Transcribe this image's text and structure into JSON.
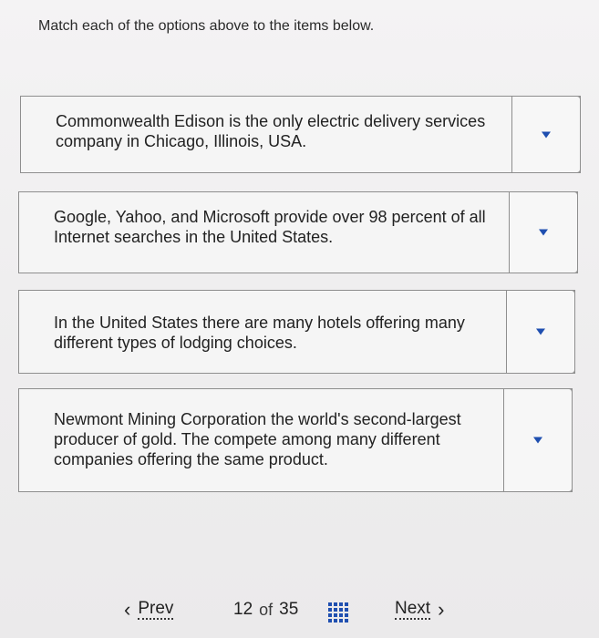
{
  "instruction": "Match each of the options above to the items below.",
  "items": [
    {
      "text": "Commonwealth Edison is the only electric delivery services company in Chicago, Illinois, USA."
    },
    {
      "text": "Google, Yahoo, and Microsoft provide over 98 percent of all Internet searches in the United States."
    },
    {
      "text": "In the United States there are many hotels offering many different types of lodging choices."
    },
    {
      "text": "Newmont Mining Corporation the world's second-largest producer of gold. The compete among many different companies offering the same product."
    }
  ],
  "footer": {
    "prev_label": "Prev",
    "current_page": "12",
    "of_label": "of",
    "total_pages": "35",
    "next_label": "Next"
  },
  "icons": {
    "prev": "chevron-left-icon",
    "next": "chevron-right-icon",
    "grid": "grid-icon",
    "dropdown": "caret-down-icon"
  },
  "colors": {
    "accent": "#1f4fb0"
  }
}
